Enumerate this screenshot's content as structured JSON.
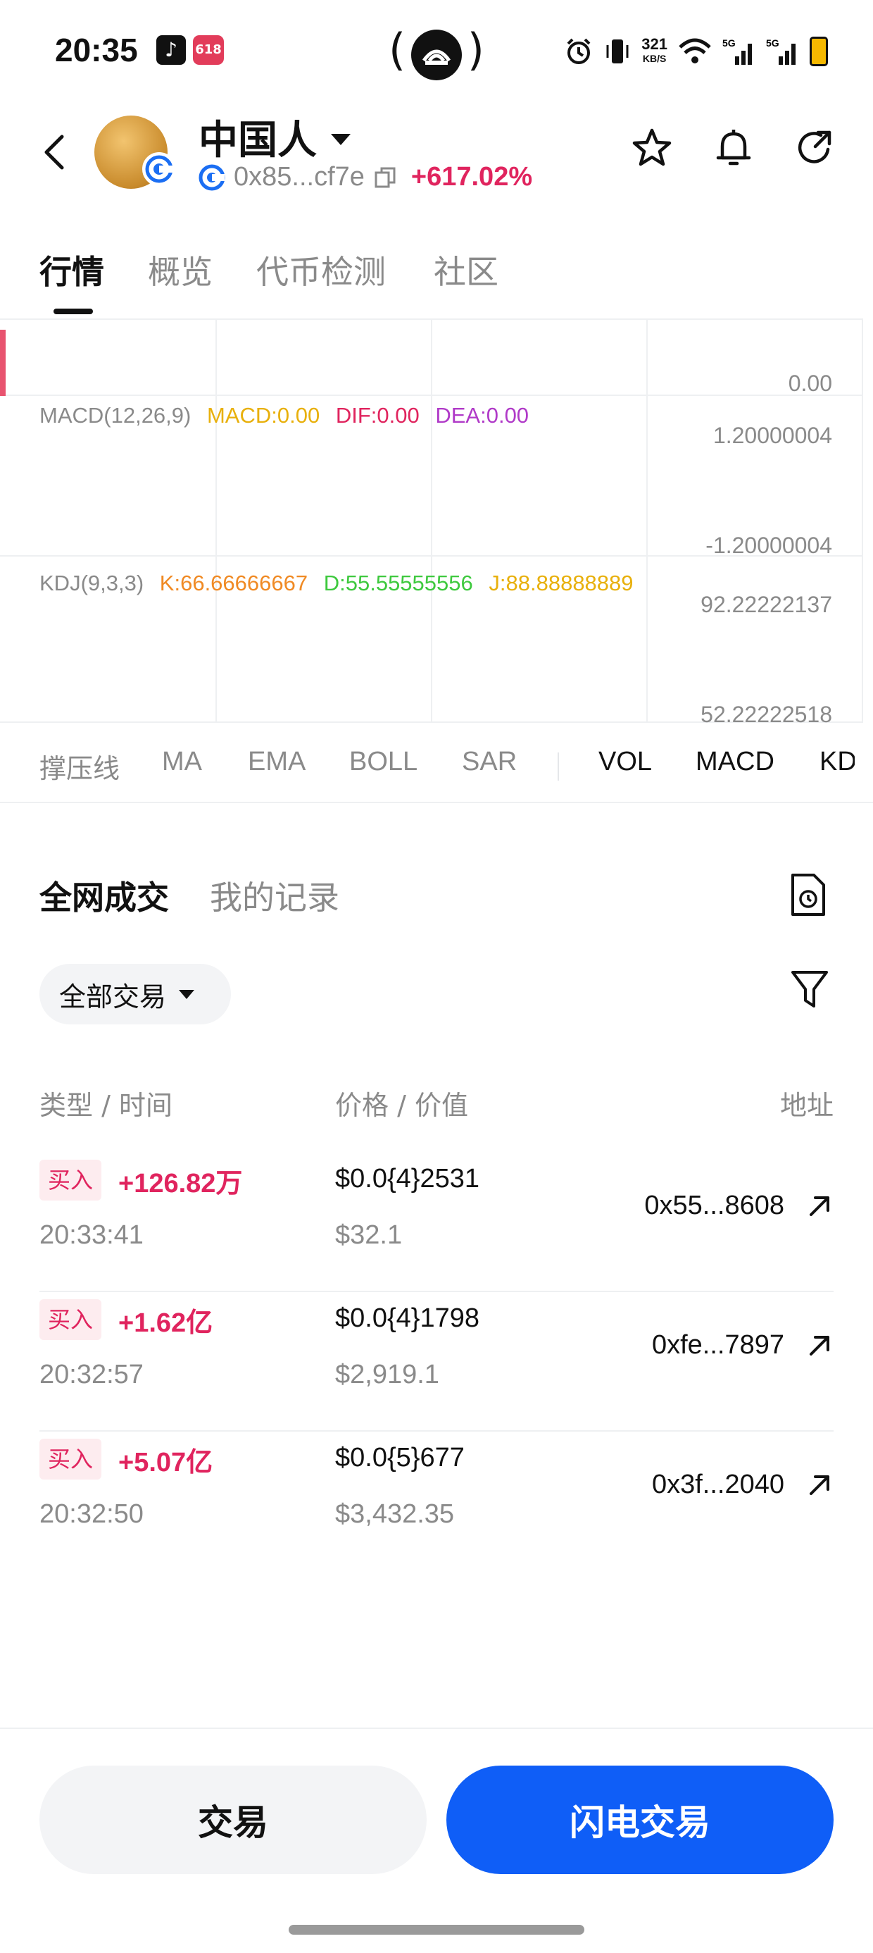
{
  "status_bar": {
    "time": "20:35",
    "app_badge": "618",
    "speed_value": "321",
    "speed_unit": "KB/S",
    "signal_1": "5G",
    "signal_2": "5G"
  },
  "header": {
    "token_name": "中国人",
    "address": "0x85...cf7e",
    "change_pct": "+617.02%",
    "actions": [
      "star-icon",
      "bell-icon",
      "share-icon"
    ]
  },
  "tabs": [
    {
      "label": "行情",
      "active": true
    },
    {
      "label": "概览",
      "active": false
    },
    {
      "label": "代币检测",
      "active": false
    },
    {
      "label": "社区",
      "active": false
    }
  ],
  "chart": {
    "volume_axis_label": "0.00",
    "macd": {
      "name": "MACD(12,26,9)",
      "macd": "MACD:0.00",
      "dif": "DIF:0.00",
      "dea": "DEA:0.00",
      "axis_top": "1.20000004",
      "axis_bottom": "-1.20000004"
    },
    "kdj": {
      "name": "KDJ(9,3,3)",
      "k": "K:66.66666667",
      "d": "D:55.55555556",
      "j": "J:88.88888889",
      "axis_top": "92.22222137",
      "axis_bottom": "52.22222518"
    },
    "colors": {
      "macd": "#e8b00c",
      "dif": "#e0245e",
      "dea": "#b03ac8",
      "k": "#f08a24",
      "d": "#3ec93e",
      "j": "#e8b00c"
    }
  },
  "indicator_toolbar": {
    "items": [
      "撑压线",
      "MA",
      "EMA",
      "BOLL",
      "SAR",
      "VOL",
      "MACD",
      "KD"
    ]
  },
  "trades": {
    "tabs": [
      "全网成交",
      "我的记录"
    ],
    "filter": "全部交易",
    "columns": {
      "type_time": "类型 / 时间",
      "price_value": "价格 / 价值",
      "address": "地址"
    },
    "rows": [
      {
        "type": "买入",
        "amount": "+126.82万",
        "time": "20:33:41",
        "price": "$0.0{4}2531",
        "value": "$32.1",
        "address": "0x55...8608"
      },
      {
        "type": "买入",
        "amount": "+1.62亿",
        "time": "20:32:57",
        "price": "$0.0{4}1798",
        "value": "$2,919.1",
        "address": "0xfe...7897"
      },
      {
        "type": "买入",
        "amount": "+5.07亿",
        "time": "20:32:50",
        "price": "$0.0{5}677",
        "value": "$3,432.35",
        "address": "0x3f...2040"
      }
    ]
  },
  "bottom": {
    "trade_label": "交易",
    "flash_trade_label": "闪电交易",
    "accent": "#0f5ef7"
  }
}
